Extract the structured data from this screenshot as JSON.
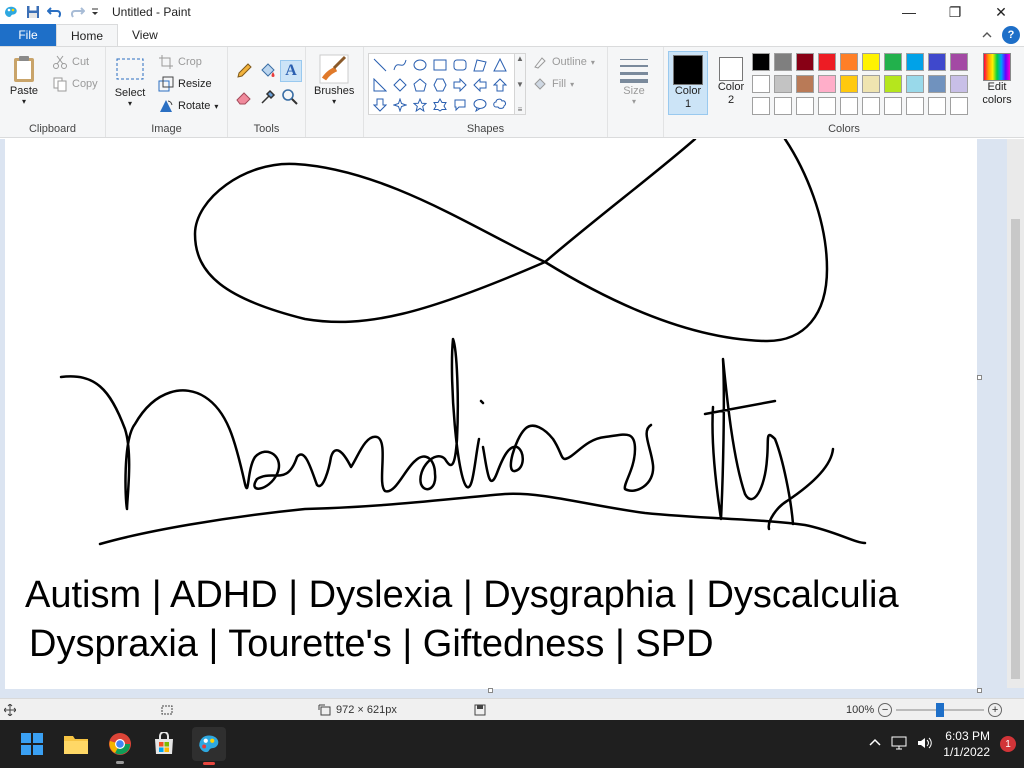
{
  "window": {
    "title": "Untitled - Paint",
    "minimize_label": "—",
    "maximize_label": "❐",
    "close_label": "✕"
  },
  "tabs": {
    "file": "File",
    "home": "Home",
    "view": "View"
  },
  "ribbon": {
    "clipboard": {
      "label": "Clipboard",
      "paste": "Paste",
      "cut": "Cut",
      "copy": "Copy"
    },
    "image": {
      "label": "Image",
      "select": "Select",
      "crop": "Crop",
      "resize": "Resize",
      "rotate": "Rotate"
    },
    "tools": {
      "label": "Tools"
    },
    "brushes": {
      "label": "Brushes"
    },
    "shapes": {
      "label": "Shapes",
      "outline": "Outline",
      "fill": "Fill"
    },
    "size": {
      "label": "Size"
    },
    "colors": {
      "label": "Colors",
      "color1": "Color 1",
      "color1_line1": "Color",
      "color1_line2": "1",
      "color2_line1": "Color",
      "color2_line2": "2",
      "edit_line1": "Edit",
      "edit_line2": "colors",
      "color1_value": "#000000",
      "color2_value": "#ffffff",
      "palette": [
        "#000000",
        "#7f7f7f",
        "#880015",
        "#ed1c24",
        "#ff7f27",
        "#fff200",
        "#22b14c",
        "#00a2e8",
        "#3f48cc",
        "#a349a4",
        "#ffffff",
        "#c3c3c3",
        "#b97a57",
        "#ffaec9",
        "#ffc90e",
        "#efe4b0",
        "#b5e61d",
        "#99d9ea",
        "#7092be",
        "#c8bfe7",
        "#ffffff",
        "#ffffff",
        "#ffffff",
        "#ffffff",
        "#ffffff",
        "#ffffff",
        "#ffffff",
        "#ffffff",
        "#ffffff",
        "#ffffff"
      ]
    }
  },
  "canvas": {
    "text_line1": "Autism | ADHD | Dyslexia | Dysgraphia | Dyscalculia",
    "text_line2": "Dyspraxia | Tourette's | Giftedness | SPD"
  },
  "statusbar": {
    "dimensions": "972 × 621px",
    "zoom": "100%"
  },
  "taskbar": {
    "time": "6:03 PM",
    "date": "1/1/2022",
    "notifications": "1"
  }
}
